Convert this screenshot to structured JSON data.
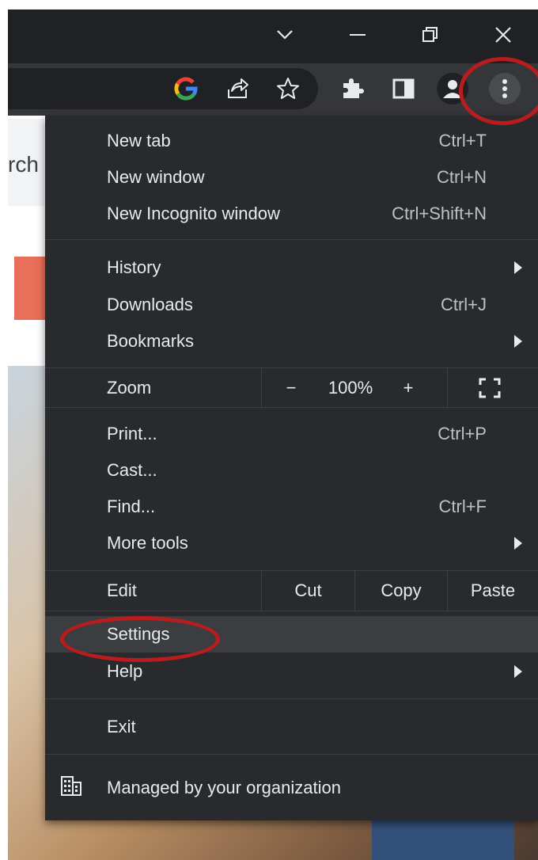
{
  "background": {
    "search_fragment": "rch"
  },
  "menu": {
    "group1": [
      {
        "label": "New tab",
        "shortcut": "Ctrl+T"
      },
      {
        "label": "New window",
        "shortcut": "Ctrl+N"
      },
      {
        "label": "New Incognito window",
        "shortcut": "Ctrl+Shift+N"
      }
    ],
    "group2": [
      {
        "label": "History",
        "shortcut": ""
      },
      {
        "label": "Downloads",
        "shortcut": "Ctrl+J"
      },
      {
        "label": "Bookmarks",
        "shortcut": ""
      }
    ],
    "zoom": {
      "label": "Zoom",
      "minus": "−",
      "value": "100%",
      "plus": "+"
    },
    "group3": [
      {
        "label": "Print...",
        "shortcut": "Ctrl+P"
      },
      {
        "label": "Cast...",
        "shortcut": ""
      },
      {
        "label": "Find...",
        "shortcut": "Ctrl+F"
      },
      {
        "label": "More tools",
        "shortcut": ""
      }
    ],
    "edit": {
      "label": "Edit",
      "cut": "Cut",
      "copy": "Copy",
      "paste": "Paste"
    },
    "settings": {
      "label": "Settings"
    },
    "help": {
      "label": "Help"
    },
    "exit": {
      "label": "Exit"
    },
    "managed": {
      "label": "Managed by your organization"
    }
  },
  "colors": {
    "menu_bg": "#292a2d",
    "toolbar_bg": "#35363a",
    "titlebar_bg": "#202124",
    "annotation_red": "#b91c1c"
  },
  "icons": {
    "titlebar": [
      "chevron-down-icon",
      "minimize-icon",
      "restore-icon",
      "close-icon"
    ],
    "toolbar": [
      "google-icon",
      "share-icon",
      "star-icon",
      "extensions-icon",
      "side-panel-icon",
      "profile-icon",
      "more-vert-icon"
    ]
  }
}
